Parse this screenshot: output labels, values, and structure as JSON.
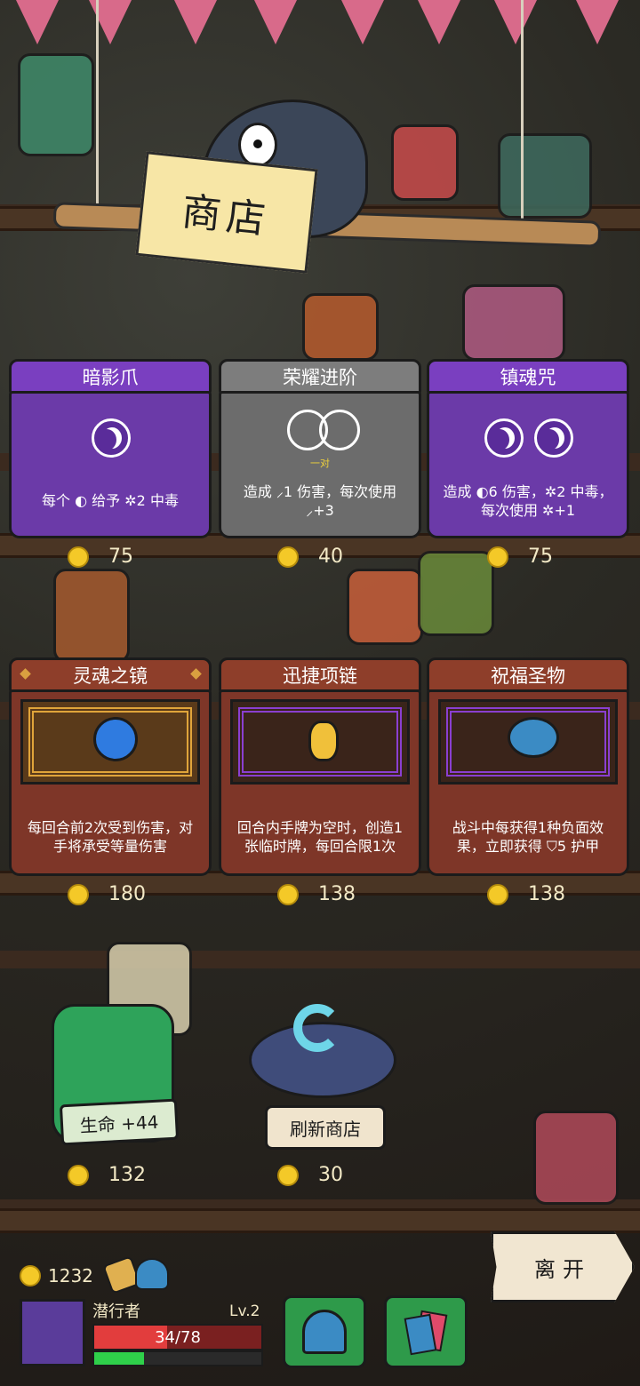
{
  "shop": {
    "title": "商店"
  },
  "cards": [
    {
      "name": "暗影爪",
      "rarity": "purple",
      "desc": "每个 ◐ 给予 ✲2 中毒",
      "price": "75"
    },
    {
      "name": "荣耀进阶",
      "rarity": "gray",
      "pair_label": "一对",
      "desc": "造成 ⸝1 伤害，每次使用 ⸝+3",
      "price": "40"
    },
    {
      "name": "镇魂咒",
      "rarity": "purple",
      "desc": "造成 ◐6 伤害，✲2 中毒，每次使用 ✲+1",
      "price": "75"
    }
  ],
  "relics": [
    {
      "name": "灵魂之镜",
      "desc": "每回合前2次受到伤害，对手将承受等量伤害",
      "price": "180",
      "icon": "soul-mirror-icon"
    },
    {
      "name": "迅捷项链",
      "desc": "回合内手牌为空时，创造1张临时牌，每回合限1次",
      "price": "138",
      "icon": "swift-necklace-icon"
    },
    {
      "name": "祝福圣物",
      "desc": "战斗中每获得1种负面效果，立即获得 ⛉5 护甲",
      "price": "138",
      "icon": "blessed-relic-icon"
    }
  ],
  "potion": {
    "label": "生命 +44",
    "price": "132"
  },
  "refresh": {
    "label": "刷新商店",
    "price": "30"
  },
  "leave": {
    "label": "离开"
  },
  "player": {
    "gold": "1232",
    "name": "潜行者",
    "level": "Lv.2",
    "hp_text": "34/78",
    "hp_fraction": 0.436,
    "xp_fraction": 0.3
  },
  "colors": {
    "purple_card": "#6b3aa8",
    "gray_card": "#6c6c6c",
    "relic_card": "#7e3628",
    "coin": "#f4c928"
  }
}
